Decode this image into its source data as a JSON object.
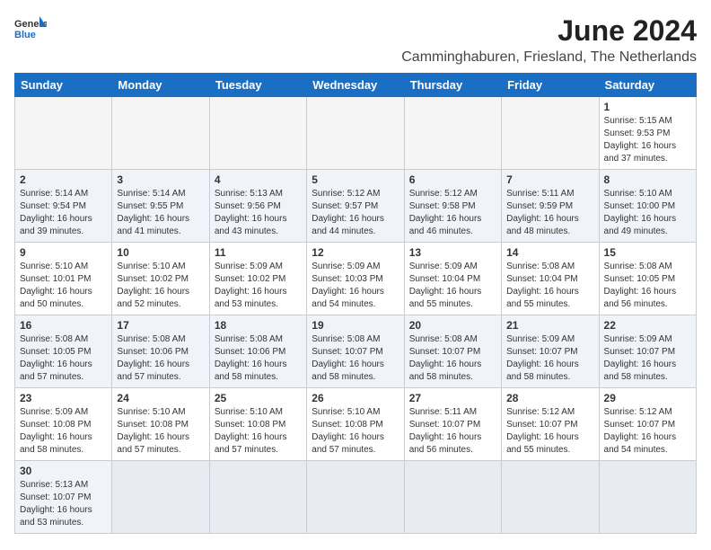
{
  "header": {
    "logo_general": "General",
    "logo_blue": "Blue",
    "month_year": "June 2024",
    "location": "Camminghaburen, Friesland, The Netherlands"
  },
  "days_of_week": [
    "Sunday",
    "Monday",
    "Tuesday",
    "Wednesday",
    "Thursday",
    "Friday",
    "Saturday"
  ],
  "weeks": [
    [
      {
        "day": "",
        "info": ""
      },
      {
        "day": "",
        "info": ""
      },
      {
        "day": "",
        "info": ""
      },
      {
        "day": "",
        "info": ""
      },
      {
        "day": "",
        "info": ""
      },
      {
        "day": "",
        "info": ""
      },
      {
        "day": "1",
        "info": "Sunrise: 5:15 AM\nSunset: 9:53 PM\nDaylight: 16 hours and 37 minutes."
      }
    ],
    [
      {
        "day": "2",
        "info": "Sunrise: 5:14 AM\nSunset: 9:54 PM\nDaylight: 16 hours and 39 minutes."
      },
      {
        "day": "3",
        "info": "Sunrise: 5:14 AM\nSunset: 9:55 PM\nDaylight: 16 hours and 41 minutes."
      },
      {
        "day": "4",
        "info": "Sunrise: 5:13 AM\nSunset: 9:56 PM\nDaylight: 16 hours and 43 minutes."
      },
      {
        "day": "5",
        "info": "Sunrise: 5:12 AM\nSunset: 9:57 PM\nDaylight: 16 hours and 44 minutes."
      },
      {
        "day": "6",
        "info": "Sunrise: 5:12 AM\nSunset: 9:58 PM\nDaylight: 16 hours and 46 minutes."
      },
      {
        "day": "7",
        "info": "Sunrise: 5:11 AM\nSunset: 9:59 PM\nDaylight: 16 hours and 48 minutes."
      },
      {
        "day": "8",
        "info": "Sunrise: 5:10 AM\nSunset: 10:00 PM\nDaylight: 16 hours and 49 minutes."
      }
    ],
    [
      {
        "day": "9",
        "info": "Sunrise: 5:10 AM\nSunset: 10:01 PM\nDaylight: 16 hours and 50 minutes."
      },
      {
        "day": "10",
        "info": "Sunrise: 5:10 AM\nSunset: 10:02 PM\nDaylight: 16 hours and 52 minutes."
      },
      {
        "day": "11",
        "info": "Sunrise: 5:09 AM\nSunset: 10:02 PM\nDaylight: 16 hours and 53 minutes."
      },
      {
        "day": "12",
        "info": "Sunrise: 5:09 AM\nSunset: 10:03 PM\nDaylight: 16 hours and 54 minutes."
      },
      {
        "day": "13",
        "info": "Sunrise: 5:09 AM\nSunset: 10:04 PM\nDaylight: 16 hours and 55 minutes."
      },
      {
        "day": "14",
        "info": "Sunrise: 5:08 AM\nSunset: 10:04 PM\nDaylight: 16 hours and 55 minutes."
      },
      {
        "day": "15",
        "info": "Sunrise: 5:08 AM\nSunset: 10:05 PM\nDaylight: 16 hours and 56 minutes."
      }
    ],
    [
      {
        "day": "16",
        "info": "Sunrise: 5:08 AM\nSunset: 10:05 PM\nDaylight: 16 hours and 57 minutes."
      },
      {
        "day": "17",
        "info": "Sunrise: 5:08 AM\nSunset: 10:06 PM\nDaylight: 16 hours and 57 minutes."
      },
      {
        "day": "18",
        "info": "Sunrise: 5:08 AM\nSunset: 10:06 PM\nDaylight: 16 hours and 58 minutes."
      },
      {
        "day": "19",
        "info": "Sunrise: 5:08 AM\nSunset: 10:07 PM\nDaylight: 16 hours and 58 minutes."
      },
      {
        "day": "20",
        "info": "Sunrise: 5:08 AM\nSunset: 10:07 PM\nDaylight: 16 hours and 58 minutes."
      },
      {
        "day": "21",
        "info": "Sunrise: 5:09 AM\nSunset: 10:07 PM\nDaylight: 16 hours and 58 minutes."
      },
      {
        "day": "22",
        "info": "Sunrise: 5:09 AM\nSunset: 10:07 PM\nDaylight: 16 hours and 58 minutes."
      }
    ],
    [
      {
        "day": "23",
        "info": "Sunrise: 5:09 AM\nSunset: 10:08 PM\nDaylight: 16 hours and 58 minutes."
      },
      {
        "day": "24",
        "info": "Sunrise: 5:10 AM\nSunset: 10:08 PM\nDaylight: 16 hours and 57 minutes."
      },
      {
        "day": "25",
        "info": "Sunrise: 5:10 AM\nSunset: 10:08 PM\nDaylight: 16 hours and 57 minutes."
      },
      {
        "day": "26",
        "info": "Sunrise: 5:10 AM\nSunset: 10:08 PM\nDaylight: 16 hours and 57 minutes."
      },
      {
        "day": "27",
        "info": "Sunrise: 5:11 AM\nSunset: 10:07 PM\nDaylight: 16 hours and 56 minutes."
      },
      {
        "day": "28",
        "info": "Sunrise: 5:12 AM\nSunset: 10:07 PM\nDaylight: 16 hours and 55 minutes."
      },
      {
        "day": "29",
        "info": "Sunrise: 5:12 AM\nSunset: 10:07 PM\nDaylight: 16 hours and 54 minutes."
      }
    ],
    [
      {
        "day": "30",
        "info": "Sunrise: 5:13 AM\nSunset: 10:07 PM\nDaylight: 16 hours and 53 minutes."
      },
      {
        "day": "",
        "info": ""
      },
      {
        "day": "",
        "info": ""
      },
      {
        "day": "",
        "info": ""
      },
      {
        "day": "",
        "info": ""
      },
      {
        "day": "",
        "info": ""
      },
      {
        "day": "",
        "info": ""
      }
    ]
  ]
}
